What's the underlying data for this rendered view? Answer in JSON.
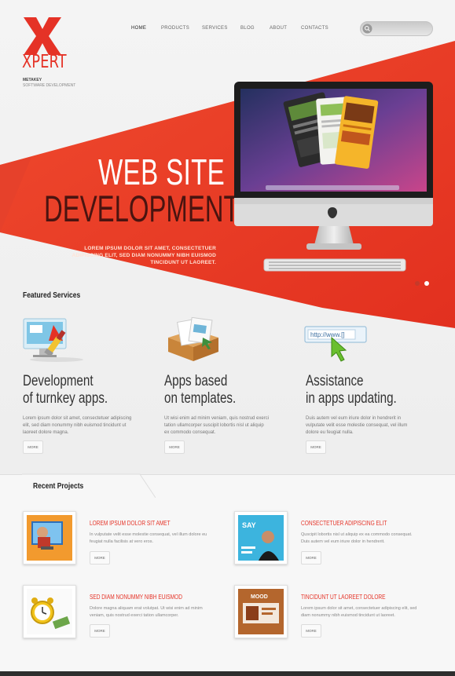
{
  "header": {
    "logo_text": "XPERT",
    "tagline_line1": "METAKEY",
    "tagline_line2": "SOFTWARE DEVELOPMENT",
    "nav": [
      "HOME",
      "PRODUCTS",
      "SERVICES",
      "BLOG",
      "ABOUT",
      "CONTACTS"
    ],
    "search_placeholder": ""
  },
  "hero": {
    "title_line1": "WEB SITE",
    "title_line2": "DEVELOPMENT",
    "desc_lines": [
      "LOREM IPSUM DOLOR SIT AMET, CONSECTETUER",
      "ADIPISCING ELIT, SED DIAM NONUMMY NIBH EUISMOD",
      "TINCIDUNT UT LAOREET."
    ],
    "slides": 2,
    "active_slide": 2
  },
  "featured": {
    "title": "Featured Services",
    "items": [
      {
        "icon": "paint-brush-monitor-icon",
        "heading_line1": "Development",
        "heading_line2": "of  turnkey apps.",
        "body_lines": [
          "Lorem ipsum dolor sit amet, consectetuer adipiscing",
          "elit, sed diam nonummy nibh euismod tincidunt ut",
          "laoreet dolore magna."
        ],
        "more_label": "MORE"
      },
      {
        "icon": "box-documents-icon",
        "heading_line1": "Apps based",
        "heading_line2": "on templates.",
        "body_lines": [
          "Ut wisi enim ad minim veniam, quis nostrud exerci",
          "tation ullamcorper suscipit lobortis nisl ut aliquip",
          "ex commodo consequat."
        ],
        "more_label": "MORE"
      },
      {
        "icon": "browser-cursor-icon",
        "heading_line1": "Assistance",
        "heading_line2": "in apps updating.",
        "body_lines": [
          "Duis autem vel eum iriure dolor in hendrerit in",
          "vulputate velit esse molestie consequat, vel illum",
          "dolore eu feugiat nulla."
        ],
        "more_label": "MORE"
      }
    ],
    "browser_icon_text": "http://www.[]"
  },
  "recent": {
    "title": "Recent Projects",
    "projects": [
      {
        "heading": "LOREM IPSUM DOLOR SIT AMET",
        "body_lines": [
          "In vulputate velit esse molestie consequat, vel illum dolore eu",
          "feugiat nulla facilisis at vero eros."
        ],
        "more_label": "MORE"
      },
      {
        "heading": "CONSECTETUER ADIPISCING ELIT",
        "body_lines": [
          "Quscipit lobortis nisl ut aliquip ex ea commodo consequat.",
          "Duis autem vel eum iriure dolor in hendrerit."
        ],
        "more_label": "MORE",
        "thumb_text": "SAY"
      },
      {
        "heading": "SED DIAM NONUMMY NIBH EUISMOD",
        "body_lines": [
          "Dolore magna aliquam erat volutpat. Ut wisi enim ad minim",
          "veniam, quis nostrud exerci tation ullamcorper."
        ],
        "more_label": "MORE"
      },
      {
        "heading": "TINCIDUNT UT LAOREET DOLORE",
        "body_lines": [
          "Lorem ipsum dolor sit amet, consectetuer adipiscing elit, sed",
          "diam nonummy nibh euismod tincidunt ut laoreet."
        ],
        "more_label": "MORE",
        "thumb_text": "MOOD"
      }
    ]
  },
  "colors": {
    "accent": "#e53226",
    "dark_text": "#333333",
    "background": "#efefef"
  }
}
